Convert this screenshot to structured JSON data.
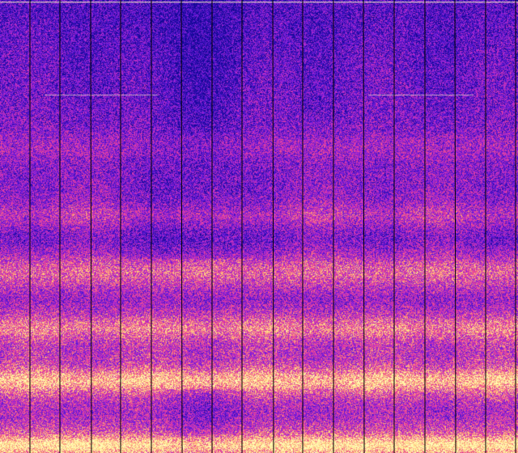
{
  "spectrogram": {
    "colormap": "magma-like",
    "colors": {
      "low": "#1a0aa0",
      "mid_low": "#6f1fd8",
      "mid": "#c12fc2",
      "mid_high": "#f0457a",
      "high": "#ffe08a",
      "peak": "#fffcc0",
      "divider": "#000000"
    },
    "segment_count": 17
  }
}
